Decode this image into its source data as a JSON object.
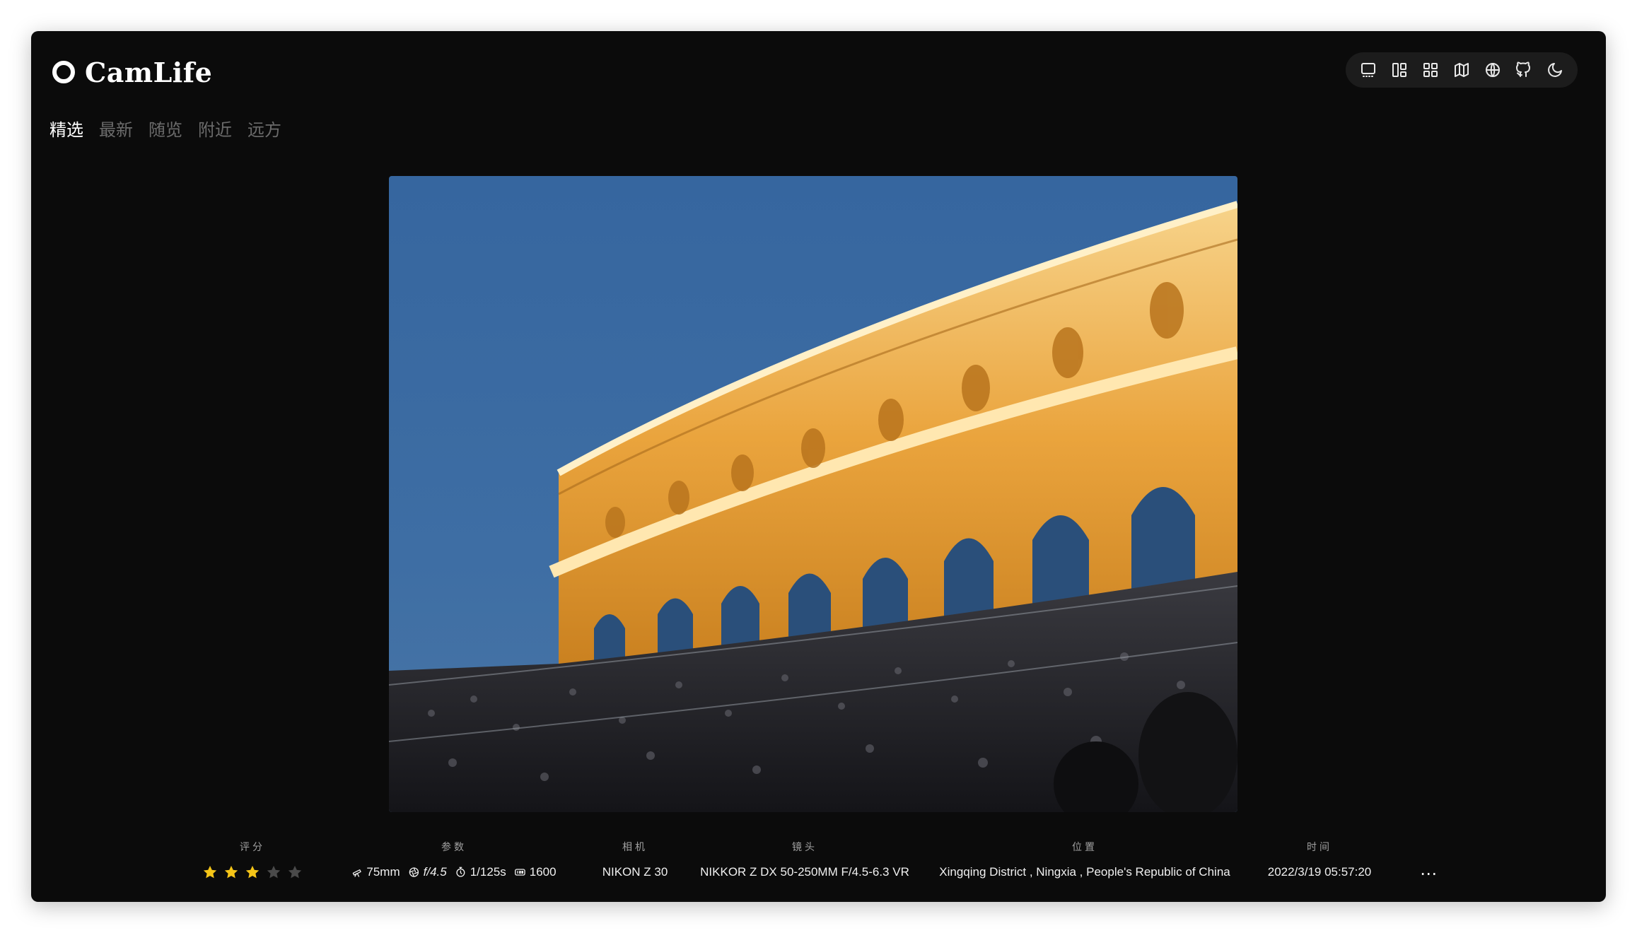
{
  "app": {
    "name": "CamLife"
  },
  "toolbar": {
    "buttons": [
      {
        "icon": "single-view-icon"
      },
      {
        "icon": "masonry-layout-icon"
      },
      {
        "icon": "grid-layout-icon"
      },
      {
        "icon": "map-icon"
      },
      {
        "icon": "globe-icon"
      },
      {
        "icon": "github-icon"
      },
      {
        "icon": "dark-mode-moon-icon"
      }
    ]
  },
  "nav": {
    "tabs": [
      {
        "label": "精选",
        "active": true
      },
      {
        "label": "最新",
        "active": false
      },
      {
        "label": "随览",
        "active": false
      },
      {
        "label": "附近",
        "active": false
      },
      {
        "label": "远方",
        "active": false
      }
    ]
  },
  "photo": {
    "icon": "photo-illuminated-colonnade-with-crowd"
  },
  "meta": {
    "rating": {
      "label": "评分",
      "value": 3,
      "max": 5,
      "star_color": "#f5c518",
      "empty_color": "#4a4a4a"
    },
    "params": {
      "label": "参数",
      "focal_length": "75mm",
      "aperture": "f/4.5",
      "shutter": "1/125s",
      "iso": "1600"
    },
    "camera": {
      "label": "相机",
      "value": "NIKON Z 30"
    },
    "lens": {
      "label": "镜头",
      "value": "NIKKOR Z DX 50-250MM F/4.5-6.3 VR"
    },
    "location": {
      "label": "位置",
      "value": "Xingqing District , Ningxia , People's Republic of China"
    },
    "time": {
      "label": "时间",
      "value": "2022/3/19 05:57:20"
    },
    "more": "⋯"
  }
}
